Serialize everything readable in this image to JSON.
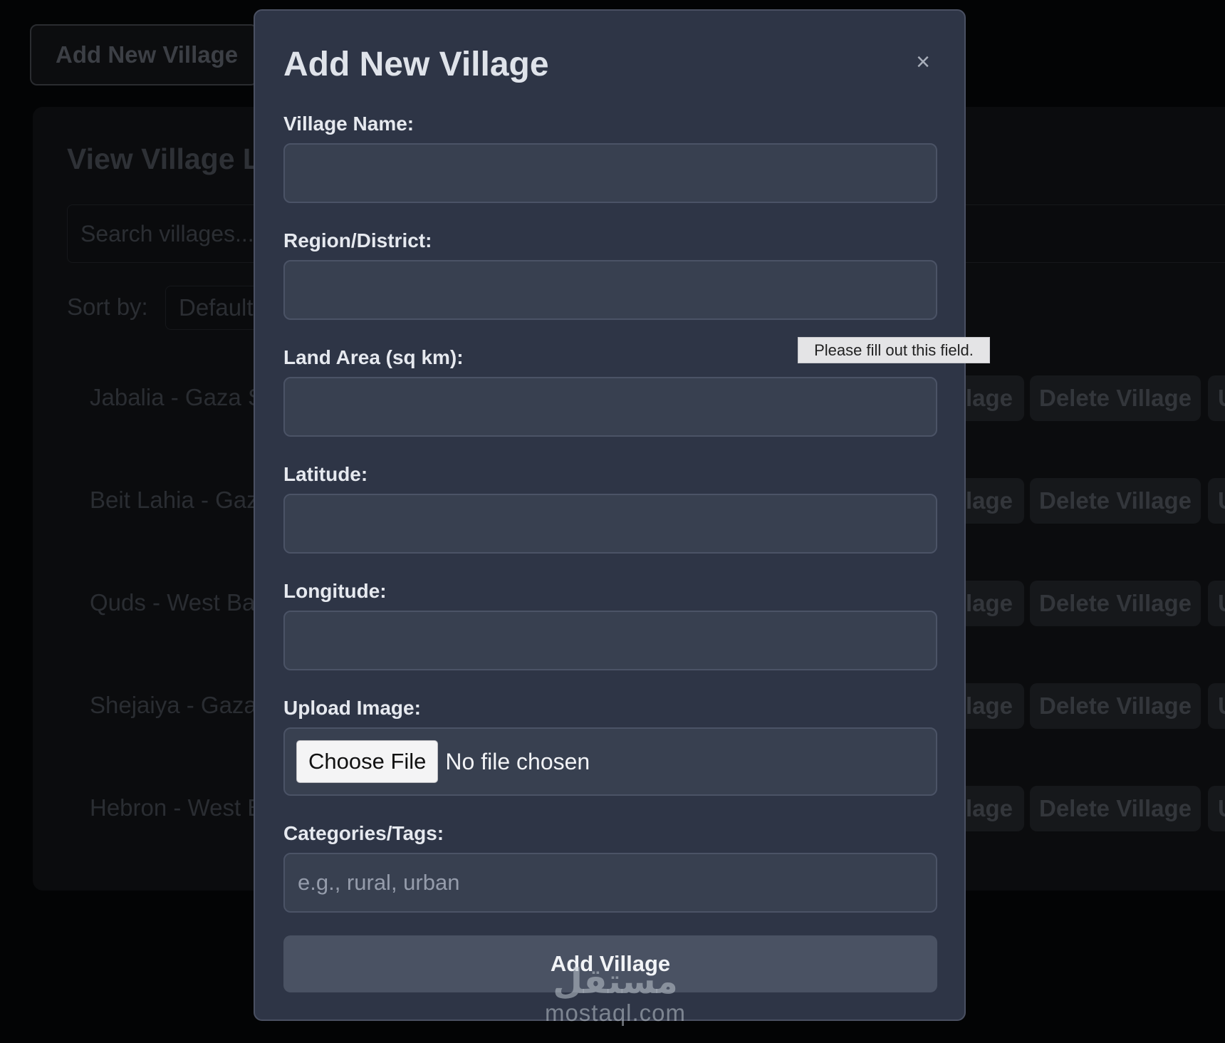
{
  "background": {
    "add_button_label": "Add New Village",
    "list_title": "View Village Li",
    "search_placeholder": "Search villages...",
    "sort_label": "Sort by:",
    "sort_value": "Default",
    "rows": [
      {
        "label": "Jabalia - Gaza S",
        "view_label": "lage",
        "delete_label": "Delete Village",
        "update_label": "U"
      },
      {
        "label": "Beit Lahia - Gaz",
        "view_label": "lage",
        "delete_label": "Delete Village",
        "update_label": "U"
      },
      {
        "label": "Quds - West Ba",
        "view_label": "lage",
        "delete_label": "Delete Village",
        "update_label": "U"
      },
      {
        "label": "Shejaiya - Gaza",
        "view_label": "lage",
        "delete_label": "Delete Village",
        "update_label": "U"
      },
      {
        "label": "Hebron - West B",
        "view_label": "lage",
        "delete_label": "Delete Village",
        "update_label": "U"
      }
    ]
  },
  "modal": {
    "title": "Add New Village",
    "close_glyph": "×",
    "fields": {
      "village_name": {
        "label": "Village Name:",
        "value": ""
      },
      "region": {
        "label": "Region/District:",
        "value": ""
      },
      "land_area": {
        "label": "Land Area (sq km):",
        "value": ""
      },
      "latitude": {
        "label": "Latitude:",
        "value": ""
      },
      "longitude": {
        "label": "Longitude:",
        "value": ""
      },
      "upload_image": {
        "label": "Upload Image:",
        "button_label": "Choose File",
        "status": "No file chosen"
      },
      "tags": {
        "label": "Categories/Tags:",
        "value": "",
        "placeholder": "e.g., rural, urban"
      }
    },
    "submit_label": "Add Village"
  },
  "tooltip": {
    "text": "Please fill out this field."
  },
  "watermark": {
    "arabic": "مستقل",
    "latin": "mostaql.com"
  },
  "colors": {
    "page_background": "#030405",
    "modal_background": "#2e3546",
    "input_background": "#384050",
    "submit_button": "#4a5263"
  }
}
